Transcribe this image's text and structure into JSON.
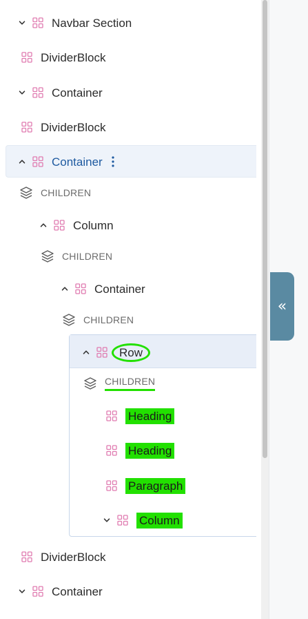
{
  "tree": {
    "items": [
      {
        "label": "Navbar Section",
        "chevron": "chevron-down"
      },
      {
        "label": "DividerBlock"
      },
      {
        "label": "Container",
        "chevron": "chevron-down"
      },
      {
        "label": "DividerBlock"
      },
      {
        "label": "Container",
        "chevron": "chevron-up",
        "selected": true
      },
      {
        "label": "CHILDREN"
      },
      {
        "label": "Column",
        "chevron": "chevron-up"
      },
      {
        "label": "CHILDREN"
      },
      {
        "label": "Container",
        "chevron": "chevron-up"
      },
      {
        "label": "CHILDREN"
      },
      {
        "label": "Row",
        "chevron": "chevron-up"
      },
      {
        "label": "CHILDREN"
      },
      {
        "label": "Heading"
      },
      {
        "label": "Heading"
      },
      {
        "label": "Paragraph"
      },
      {
        "label": "Column",
        "chevron": "chevron-down"
      },
      {
        "label": "DividerBlock"
      },
      {
        "label": "Container",
        "chevron": "chevron-down"
      }
    ]
  },
  "collapse_button": {
    "label": "«"
  },
  "icons": {
    "element": "grid-icon",
    "children": "layers-icon",
    "menu": "kebab-menu-icon"
  },
  "colors": {
    "icon_pink": "#e07bb0",
    "selected_text": "#1e5aa0",
    "highlight_green": "#22e000",
    "collapse_button": "#5a8aa2"
  }
}
